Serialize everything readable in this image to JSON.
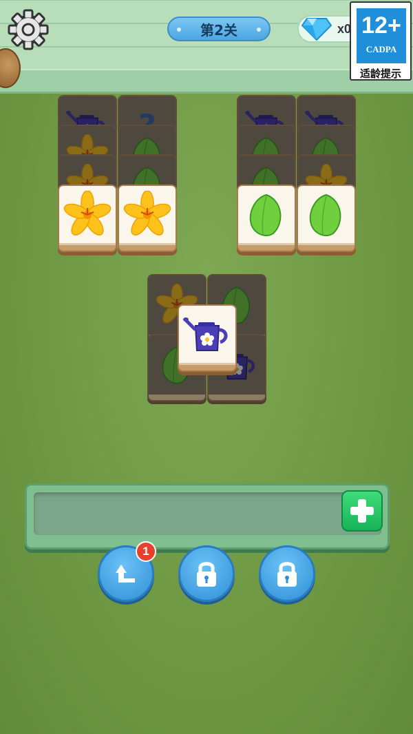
{
  "header": {
    "level_label": "第2关",
    "gem_count": "x0"
  },
  "age_badge": {
    "age": "12+",
    "org": "CADPA",
    "caption": "适龄提示"
  },
  "board": {
    "tiles": [
      {
        "group": "top-left",
        "icon": "watering-can-icon",
        "covered": true
      },
      {
        "group": "top-left",
        "icon": "question-icon",
        "covered": true
      },
      {
        "group": "top-left",
        "icon": "lily-flower-icon",
        "covered": true
      },
      {
        "group": "top-left",
        "icon": "leaf-icon",
        "covered": true
      },
      {
        "group": "top-left",
        "icon": "lily-flower-icon",
        "covered": true
      },
      {
        "group": "top-left",
        "icon": "leaf-icon",
        "covered": true
      },
      {
        "group": "top-left",
        "icon": "lily-flower-icon",
        "covered": false
      },
      {
        "group": "top-left",
        "icon": "lily-flower-icon",
        "covered": false
      },
      {
        "group": "top-right",
        "icon": "watering-can-icon",
        "covered": true
      },
      {
        "group": "top-right",
        "icon": "watering-can-icon",
        "covered": true
      },
      {
        "group": "top-right",
        "icon": "leaf-icon",
        "covered": true
      },
      {
        "group": "top-right",
        "icon": "leaf-icon",
        "covered": true
      },
      {
        "group": "top-right",
        "icon": "leaf-icon",
        "covered": true
      },
      {
        "group": "top-right",
        "icon": "lily-flower-icon",
        "covered": true
      },
      {
        "group": "top-right",
        "icon": "leaf-icon",
        "covered": false
      },
      {
        "group": "top-right",
        "icon": "leaf-icon",
        "covered": false
      },
      {
        "group": "center",
        "icon": "lily-flower-icon",
        "covered": true
      },
      {
        "group": "center",
        "icon": "leaf-icon",
        "covered": true
      },
      {
        "group": "center",
        "icon": "leaf-icon",
        "covered": true
      },
      {
        "group": "center",
        "icon": "watering-can-icon",
        "covered": true
      },
      {
        "group": "center",
        "icon": "watering-can-icon",
        "covered": false
      }
    ]
  },
  "tools": {
    "undo_count": "1"
  },
  "colors": {
    "grass": "#6f9a44",
    "wall": "#b7ddb9",
    "accent_blue": "#4ba6e0",
    "plus_green": "#17b356",
    "badge_blue": "#1e8fd8",
    "notif_red": "#e8402f"
  }
}
